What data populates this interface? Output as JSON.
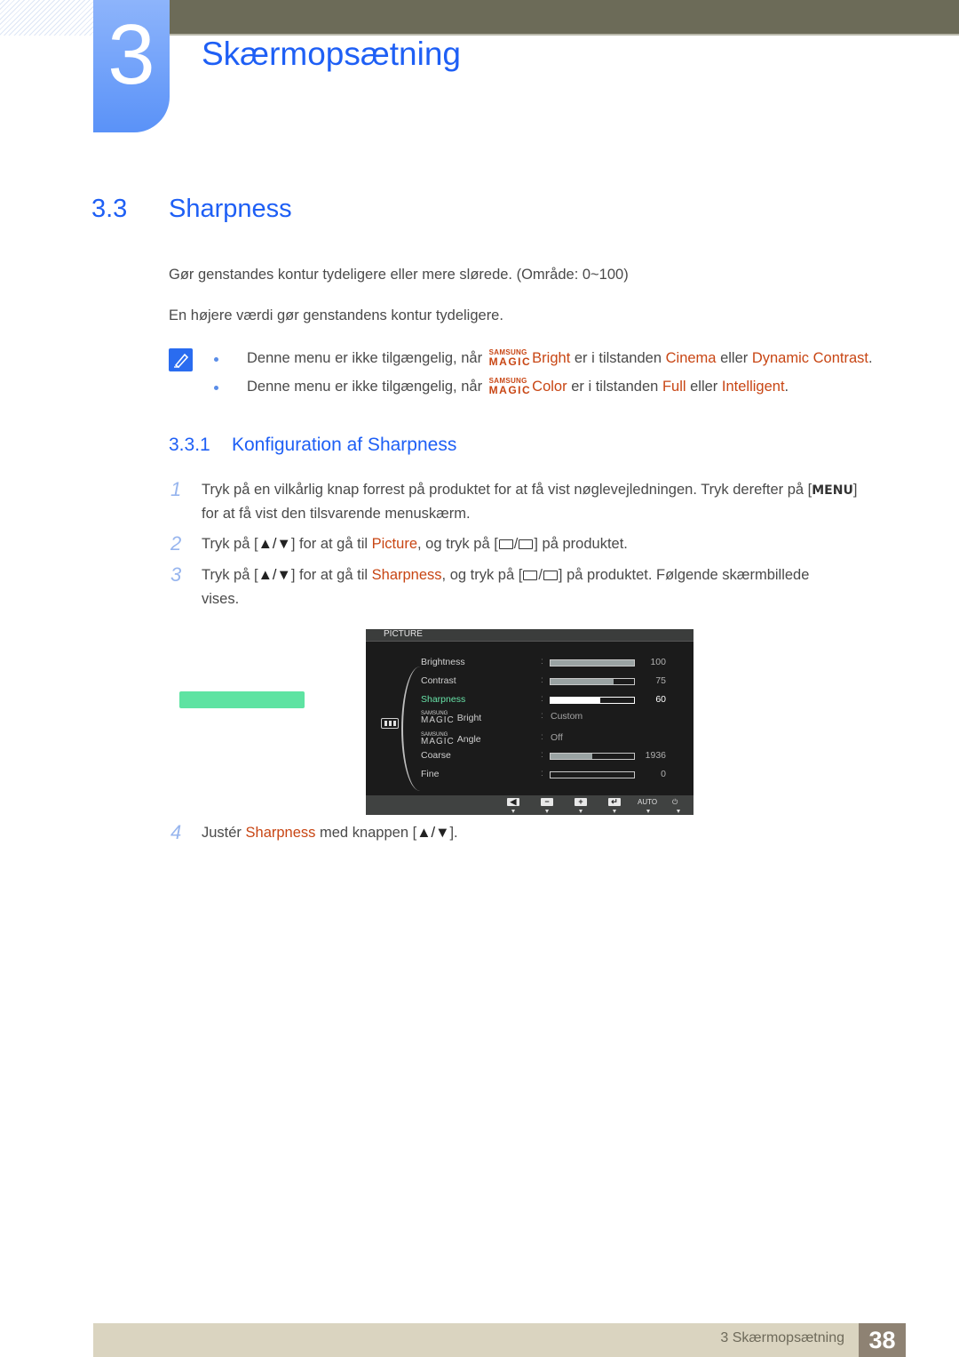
{
  "header": {
    "chapter_number": "3",
    "chapter_title": "Skærmopsætning"
  },
  "section": {
    "number": "3.3",
    "title": "Sharpness",
    "paragraphs": [
      "Gør genstandes kontur tydeligere eller mere slørede. (Område: 0~100)",
      "En højere værdi gør genstandens kontur tydeligere."
    ]
  },
  "notes": [
    {
      "prefix": "Denne menu er ikke tilgængelig, når",
      "magic_top": "SAMSUNG",
      "magic_bottom": "MAGIC",
      "feature": "Bright",
      "middle": "er i tilstanden",
      "mode1": "Cinema",
      "or": "eller",
      "mode2": "Dynamic Contrast",
      "end": "."
    },
    {
      "prefix": "Denne menu er ikke tilgængelig, når",
      "magic_top": "SAMSUNG",
      "magic_bottom": "MAGIC",
      "feature": "Color",
      "middle": "er i tilstanden",
      "mode1": "Full",
      "or": "eller",
      "mode2": "Intelligent",
      "end": "."
    }
  ],
  "subsection": {
    "number": "3.3.1",
    "title": "Konfiguration af Sharpness"
  },
  "steps": [
    {
      "num": "1",
      "line1_a": "Tryk på en vilkårlig knap forrest på produktet for at få vist nøglevejledningen. Tryk derefter på [",
      "key": "MENU",
      "line1_b": "]",
      "line2": "for at få vist den tilsvarende menuskærm."
    },
    {
      "num": "2",
      "a": "Tryk på [",
      "arrows": "▲/▼",
      "b": "] for at gå til",
      "target": "Picture",
      "c": ", og tryk på [",
      "d": "] på produktet."
    },
    {
      "num": "3",
      "a": "Tryk på [",
      "arrows": "▲/▼",
      "b": "] for at gå til",
      "target": "Sharpness",
      "c": ", og tryk på [",
      "d": "] på produktet. Følgende skærmbillede",
      "line2": "vises."
    },
    {
      "num": "4",
      "a": "Justér",
      "target": "Sharpness",
      "b": "med knappen [",
      "arrows": "▲/▼",
      "c": "]."
    }
  ],
  "osd": {
    "title": "PICTURE",
    "rows": [
      {
        "label": "Brightness",
        "type": "bar",
        "value": "100",
        "fill": 1.0
      },
      {
        "label": "Contrast",
        "type": "bar",
        "value": "75",
        "fill": 0.75
      },
      {
        "label": "Sharpness",
        "type": "bar",
        "value": "60",
        "fill": 0.6,
        "selected": true
      },
      {
        "label": "Bright",
        "magic_top": "SAMSUNG",
        "magic_bottom": "MAGIC",
        "type": "text",
        "value": "Custom"
      },
      {
        "label": "Angle",
        "magic_top": "SAMSUNG",
        "magic_bottom": "MAGIC",
        "type": "text",
        "value": "Off"
      },
      {
        "label": "Coarse",
        "type": "bar",
        "value": "1936",
        "fill": 0.5
      },
      {
        "label": "Fine",
        "type": "bar",
        "value": "0",
        "fill": 0.0
      }
    ],
    "footer_keys": [
      {
        "name": "left-icon",
        "glyph": "◀"
      },
      {
        "name": "minus-icon",
        "glyph": "−"
      },
      {
        "name": "plus-icon",
        "glyph": "+"
      },
      {
        "name": "enter-icon",
        "glyph": "↵"
      },
      {
        "name": "auto-label",
        "glyph": "AUTO"
      },
      {
        "name": "power-icon",
        "glyph": "⏻"
      }
    ]
  },
  "footer": {
    "text": "3 Skærmopsætning",
    "page": "38"
  },
  "colors": {
    "heading_blue": "#1e5ff5",
    "highlight_orange": "#c84614",
    "osd_selected": "#5ee3a2",
    "footer_bg": "#dad4c0",
    "page_box": "#8e8273",
    "top_bar": "#6c6b58"
  }
}
